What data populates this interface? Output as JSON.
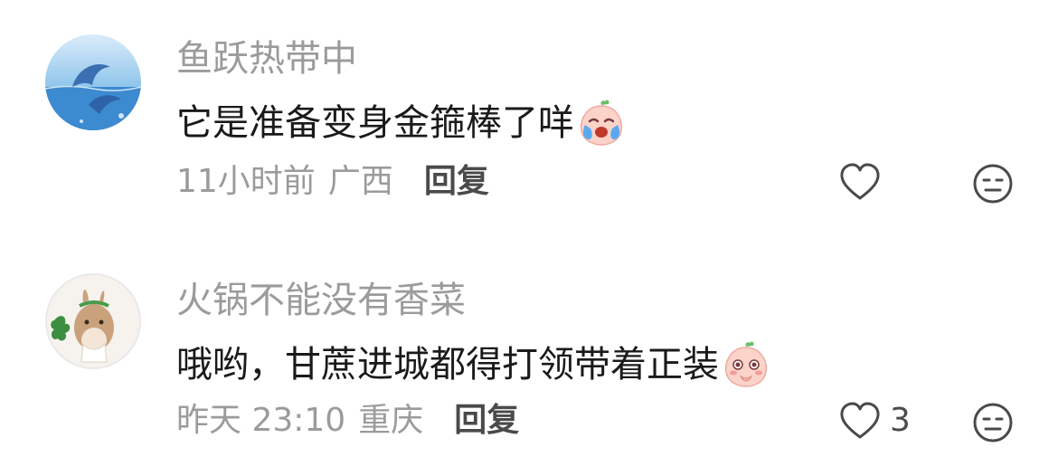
{
  "comments": [
    {
      "username": "鱼跃热带中",
      "content": "它是准备变身金箍棒了咩",
      "time": "11小时前",
      "location": "广西",
      "reply_label": "回复",
      "like_count": "",
      "emoji": "crying-peach-emoji",
      "avatar": "dolphin-ocean-avatar"
    },
    {
      "username": "火锅不能没有香菜",
      "content": "哦哟，甘蔗进城都得打领带着正装",
      "time": "昨天 23:10",
      "location": "重庆",
      "reply_label": "回复",
      "like_count": "3",
      "emoji": "shy-peach-emoji",
      "avatar": "bunny-cilantro-avatar"
    }
  ],
  "icons": {
    "like": "heart-outline-icon",
    "dislike": "meh-face-icon"
  },
  "colors": {
    "username": "#9b9b9b",
    "content": "#1a1a1a",
    "meta": "#9b9b9b",
    "reply": "#4a4a4a",
    "icon": "#4a4a4a"
  }
}
